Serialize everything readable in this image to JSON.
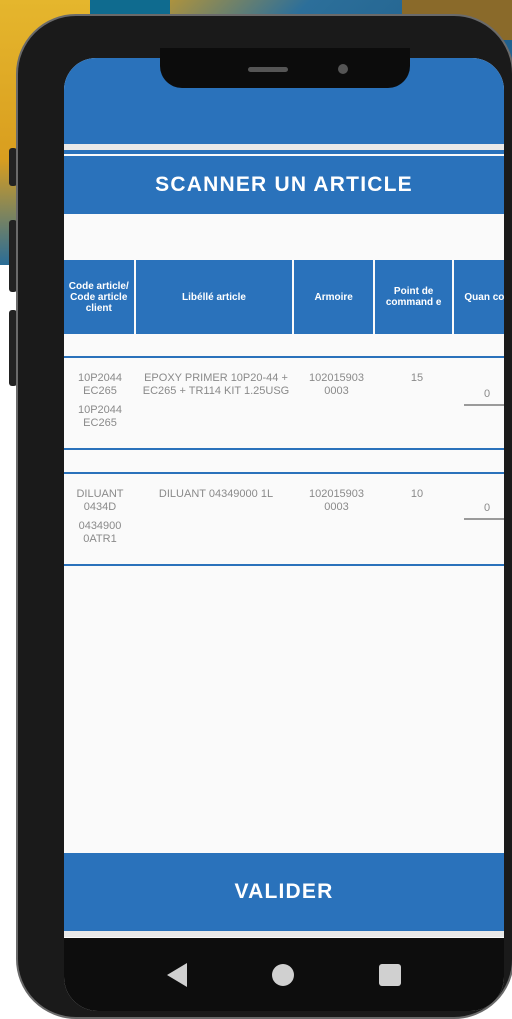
{
  "header": {
    "title": "SCANNER UN ARTICLE"
  },
  "table": {
    "columns": [
      "Code article/ Code article client",
      "Libéllé article",
      "Armoire",
      "Point de command e",
      "Quan com"
    ],
    "rows": [
      {
        "code": "10P2044 EC265",
        "code_client": "10P2044 EC265",
        "label": "EPOXY PRIMER 10P20-44 + EC265 + TR114 KIT 1.25USG",
        "armoire": "102015903 0003",
        "point_commande": "15",
        "quantite": "0"
      },
      {
        "code": "DILUANT 0434D",
        "code_client": "0434900 0ATR1",
        "label": "DILUANT 04349000 1L",
        "armoire": "102015903 0003",
        "point_commande": "10",
        "quantite": "0"
      }
    ]
  },
  "footer": {
    "validate_label": "VALIDER"
  },
  "navbar": {
    "icons": [
      "back-icon",
      "home-icon",
      "recent-apps-icon"
    ]
  },
  "colors": {
    "primary": "#2a72bb",
    "background": "#fafafa",
    "text_muted": "#8a8a8a"
  }
}
